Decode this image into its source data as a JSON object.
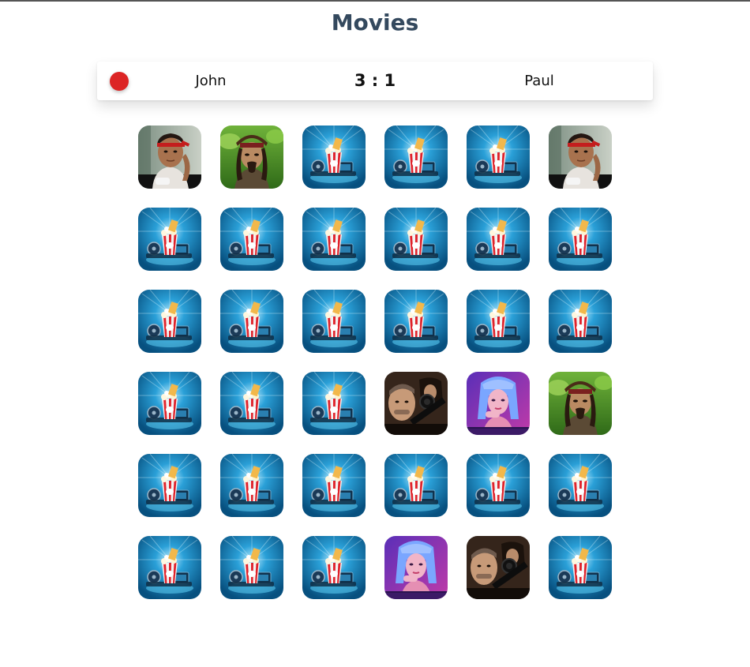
{
  "game": {
    "title": "Movies"
  },
  "scoreboard": {
    "turn_indicator_color": "#dc2424",
    "player1": "John",
    "score": "3 : 1",
    "player2": "Paul"
  },
  "board": {
    "rows": 6,
    "cols": 6,
    "cards": [
      "rambo",
      "pirate",
      "back",
      "back",
      "back",
      "rambo",
      "back",
      "back",
      "back",
      "back",
      "back",
      "back",
      "back",
      "back",
      "back",
      "back",
      "back",
      "back",
      "back",
      "back",
      "back",
      "sniper",
      "blue-hair",
      "pirate",
      "back",
      "back",
      "back",
      "back",
      "back",
      "back",
      "back",
      "back",
      "back",
      "blue-hair",
      "sniper",
      "back"
    ]
  }
}
